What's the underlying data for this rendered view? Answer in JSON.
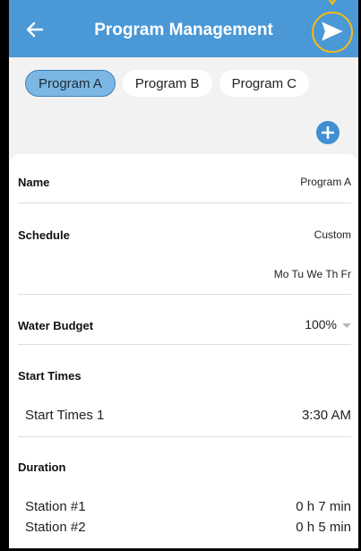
{
  "header": {
    "title": "Program Management",
    "back_icon": "arrow-left-icon",
    "send_icon": "send-icon"
  },
  "tabs": [
    {
      "label": "Program A",
      "active": true
    },
    {
      "label": "Program B",
      "active": false
    },
    {
      "label": "Program C",
      "active": false
    }
  ],
  "add_icon": "plus-icon",
  "name": {
    "label": "Name",
    "value": "Program A"
  },
  "schedule": {
    "label": "Schedule",
    "type": "Custom",
    "days": "Mo Tu We Th Fr"
  },
  "water_budget": {
    "label": "Water Budget",
    "value": "100%"
  },
  "start_times": {
    "label": "Start Times",
    "items": [
      {
        "label": "Start Times 1",
        "value": "3:30 AM"
      }
    ]
  },
  "duration": {
    "label": "Duration",
    "stations": [
      {
        "label": "Station #1",
        "value": "0 h 7 min"
      },
      {
        "label": "Station #2",
        "value": "0 h 5 min"
      }
    ]
  },
  "colors": {
    "header": "#4a98d6",
    "active_tab": "#7cb7e3",
    "highlight": "#f5b919",
    "add_button": "#3f8fd2"
  }
}
